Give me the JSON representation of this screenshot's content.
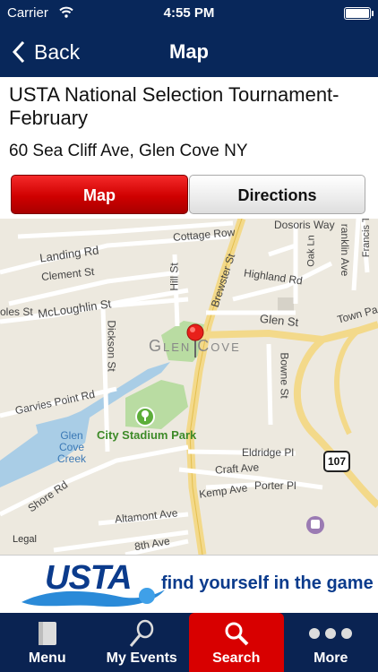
{
  "status_bar": {
    "carrier": "Carrier",
    "time": "4:55 PM"
  },
  "nav": {
    "back_label": "Back",
    "title": "Map"
  },
  "event": {
    "title": "USTA National Selection Tournament-February",
    "address": "60 Sea Cliff Ave, Glen Cove NY"
  },
  "segments": {
    "map": "Map",
    "directions": "Directions"
  },
  "map": {
    "labels": {
      "cottage_row": "Cottage Row",
      "landing_rd": "Landing Rd",
      "clement_st": "Clement St",
      "mcloughlin_st": "McLoughlin St",
      "dickson_st": "Dickson St",
      "hill_st": "Hill St",
      "brewster_st": "Brewster St",
      "highland_rd": "Highland Rd",
      "glen_st": "Glen St",
      "town_path": "Town Pa",
      "glen_cove": "Glen Cove",
      "bowne_st": "Bowne St",
      "garvies_point_rd": "Garvies Point Rd",
      "glen_cove_creek": "Glen Cove Creek",
      "city_stadium_park": "City Stadium Park",
      "eldridge_pl": "Eldridge Pl",
      "craft_ave": "Craft Ave",
      "porter_pl": "Porter Pl",
      "kemp_ave": "Kemp Ave",
      "shore_rd": "Shore Rd",
      "altamont_ave": "Altamont Ave",
      "legal": "Legal",
      "eighth_ave": "8th Ave",
      "dosoris_way": "Dosoris Way",
      "franklin_ave": "ranklin Ave",
      "francis_ter": "Francis Ter",
      "oak_ln": "Oak Ln",
      "noles_st": "oles St",
      "route_107": "107"
    }
  },
  "banner": {
    "logo": "USTA",
    "tagline": "find yourself in the game"
  },
  "tabs": [
    {
      "label": "Menu",
      "icon": "menu-book-icon"
    },
    {
      "label": "My Events",
      "icon": "racquet-icon"
    },
    {
      "label": "Search",
      "icon": "search-icon"
    },
    {
      "label": "More",
      "icon": "more-dots-icon"
    }
  ],
  "colors": {
    "nav": "#08275a",
    "accent_red": "#d80000",
    "tabbar": "#0a2352",
    "brand_blue": "#0b3b8c"
  }
}
